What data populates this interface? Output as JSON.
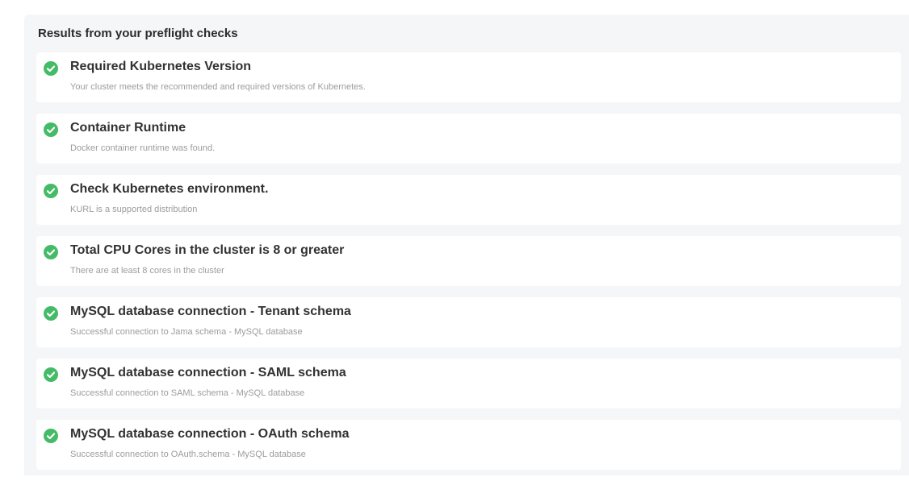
{
  "results": {
    "title": "Results from your preflight checks",
    "status_color": "#44bb66",
    "checks": [
      {
        "status": "pass",
        "icon": "check-circle-icon",
        "title": "Required Kubernetes Version",
        "message": "Your cluster meets the recommended and required versions of Kubernetes."
      },
      {
        "status": "pass",
        "icon": "check-circle-icon",
        "title": "Container Runtime",
        "message": "Docker container runtime was found."
      },
      {
        "status": "pass",
        "icon": "check-circle-icon",
        "title": "Check Kubernetes environment.",
        "message": "KURL is a supported distribution"
      },
      {
        "status": "pass",
        "icon": "check-circle-icon",
        "title": "Total CPU Cores in the cluster is 8 or greater",
        "message": "There are at least 8 cores in the cluster"
      },
      {
        "status": "pass",
        "icon": "check-circle-icon",
        "title": "MySQL database connection - Tenant schema",
        "message": "Successful connection to Jama schema - MySQL database"
      },
      {
        "status": "pass",
        "icon": "check-circle-icon",
        "title": "MySQL database connection - SAML schema",
        "message": "Successful connection to SAML schema - MySQL database"
      },
      {
        "status": "pass",
        "icon": "check-circle-icon",
        "title": "MySQL database connection - OAuth schema",
        "message": "Successful connection to OAuth.schema - MySQL database"
      }
    ]
  }
}
